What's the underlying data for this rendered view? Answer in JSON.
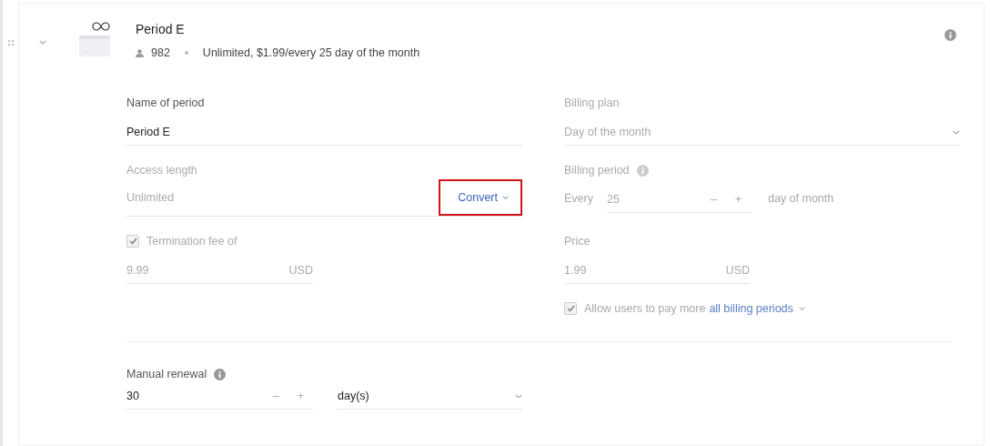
{
  "period": {
    "title": "Period E",
    "subscribers": "982",
    "summary": "Unlimited, $1.99/every 25 day of the month",
    "expanded": true
  },
  "name_of_period": {
    "label": "Name of period",
    "value": "Period E",
    "disabled": false
  },
  "billing_plan": {
    "label": "Billing plan",
    "value": "Day of the month",
    "disabled": true
  },
  "access_length": {
    "label": "Access length",
    "value": "Unlimited",
    "disabled": true,
    "convert": {
      "label": "Convert",
      "highlighted": true
    }
  },
  "billing_period": {
    "label": "Billing period",
    "prefix": "Every",
    "value": "25",
    "decrement": "–",
    "increment": "+",
    "suffix": "day of month",
    "disabled": true
  },
  "termination_fee": {
    "label": "Termination fee of",
    "checked": true,
    "value": "9.99",
    "currency": "USD",
    "disabled": true
  },
  "price": {
    "label": "Price",
    "value": "1.99",
    "currency": "USD",
    "disabled": true
  },
  "pay_more": {
    "text": "Allow users to pay more",
    "link": "all billing periods",
    "checked": true,
    "disabled": true
  },
  "manual_renewal": {
    "label": "Manual renewal",
    "value": "30",
    "decrement": "–",
    "increment": "+",
    "unit": "day(s)",
    "disabled": false
  }
}
